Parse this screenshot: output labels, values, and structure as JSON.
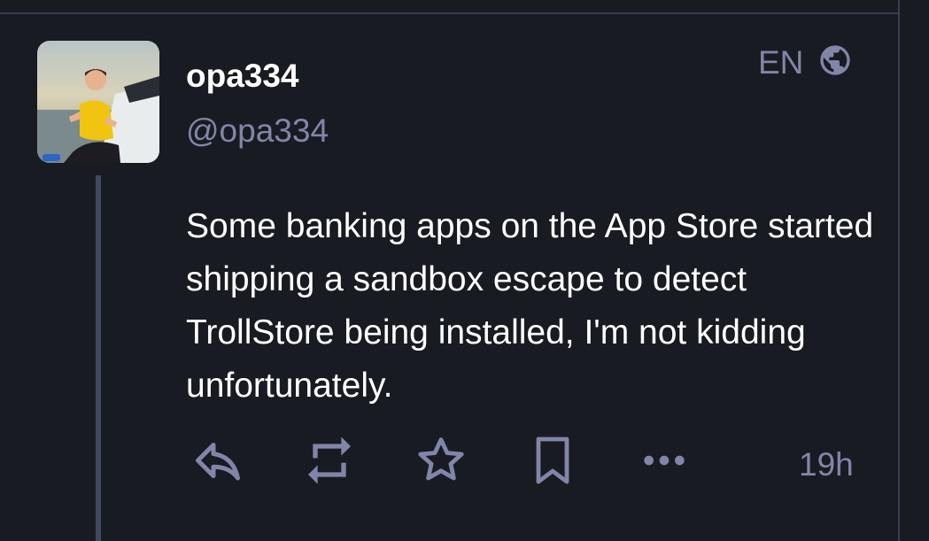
{
  "post": {
    "display_name": "opa334",
    "handle": "@opa334",
    "language": "EN",
    "content": "Some banking apps on the App Store started shipping a sandbox escape to detect TrollStore being installed, I'm not kidding unfortunately.",
    "timestamp": "19h"
  },
  "icons": {
    "language": "globe-icon",
    "reply": "reply-icon",
    "boost": "boost-icon",
    "favourite": "star-icon",
    "bookmark": "bookmark-icon",
    "more": "more-icon"
  },
  "colors": {
    "background": "#191b22",
    "muted": "#8186a8",
    "text": "#ffffff",
    "divider": "#393f4f",
    "thread_line": "#424862"
  }
}
